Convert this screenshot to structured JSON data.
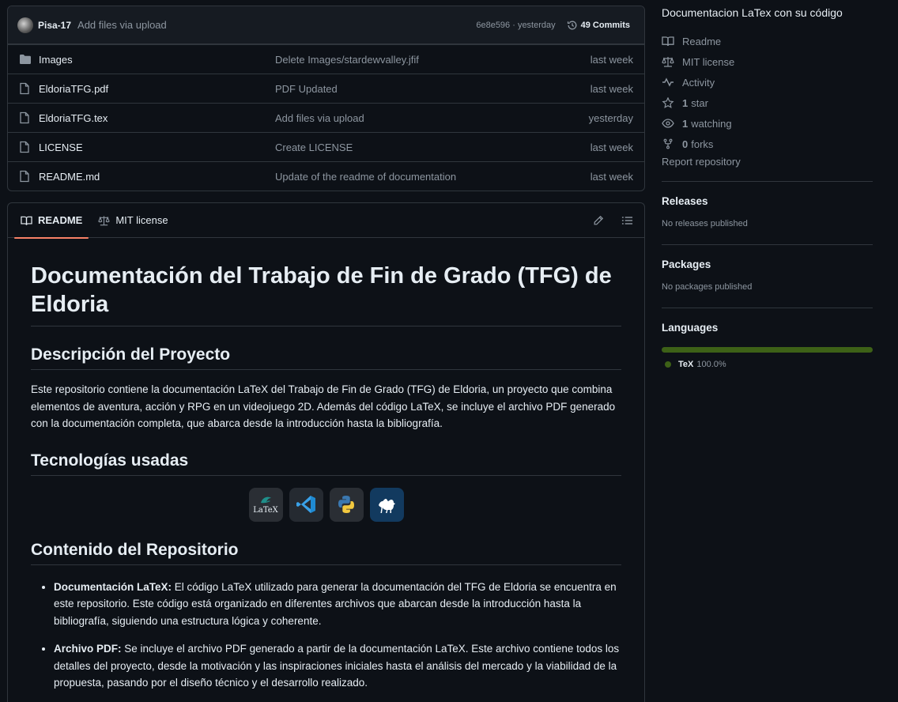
{
  "commit": {
    "author": "Pisa-17",
    "message": "Add files via upload",
    "hash_time": "6e8e596 · yesterday",
    "commits_label": "49 Commits"
  },
  "files": [
    {
      "name": "Images",
      "type": "folder",
      "commit": "Delete Images/stardewvalley.jfif",
      "date": "last week"
    },
    {
      "name": "EldoriaTFG.pdf",
      "type": "file",
      "commit": "PDF Updated",
      "date": "last week"
    },
    {
      "name": "EldoriaTFG.tex",
      "type": "file",
      "commit": "Add files via upload",
      "date": "yesterday"
    },
    {
      "name": "LICENSE",
      "type": "file",
      "commit": "Create LICENSE",
      "date": "last week"
    },
    {
      "name": "README.md",
      "type": "file",
      "commit": "Update of the readme of documentation",
      "date": "last week"
    }
  ],
  "readme_tabs": {
    "readme": "README",
    "license": "MIT license"
  },
  "readme": {
    "h1": "Documentación del Trabajo de Fin de Grado (TFG) de Eldoria",
    "h2_desc": "Descripción del Proyecto",
    "p_desc": "Este repositorio contiene la documentación LaTeX del Trabajo de Fin de Grado (TFG) de Eldoria, un proyecto que combina elementos de aventura, acción y RPG en un videojuego 2D. Además del código LaTeX, se incluye el archivo PDF generado con la documentación completa, que abarca desde la introducción hasta la bibliografía.",
    "h2_tech": "Tecnologías usadas",
    "tech_latex_label": "LaTeX",
    "h2_content": "Contenido del Repositorio",
    "items": [
      {
        "label": "Documentación LaTeX:",
        "text": " El código LaTeX utilizado para generar la documentación del TFG de Eldoria se encuentra en este repositorio. Este código está organizado en diferentes archivos que abarcan desde la introducción hasta la bibliografía, siguiendo una estructura lógica y coherente."
      },
      {
        "label": "Archivo PDF:",
        "text": " Se incluye el archivo PDF generado a partir de la documentación LaTeX. Este archivo contiene todos los detalles del proyecto, desde la motivación y las inspiraciones iniciales hasta el análisis del mercado y la viabilidad de la propuesta, pasando por el diseño técnico y el desarrollo realizado."
      }
    ]
  },
  "about": {
    "description": "Documentacion LaTex con su código",
    "readme": "Readme",
    "license": "MIT license",
    "activity": "Activity",
    "stars_count": "1",
    "stars_label": "star",
    "watching_count": "1",
    "watching_label": "watching",
    "forks_count": "0",
    "forks_label": "forks",
    "report": "Report repository"
  },
  "releases": {
    "title": "Releases",
    "sub": "No releases published"
  },
  "packages": {
    "title": "Packages",
    "sub": "No packages published"
  },
  "languages": {
    "title": "Languages",
    "items": [
      {
        "name": "TeX",
        "pct": "100.0%",
        "fraction": 1.0,
        "color": "#3d6117"
      }
    ]
  },
  "colors": {
    "accent_tab": "#f78166",
    "bg": "#0d1117",
    "muted": "#8d96a0"
  }
}
